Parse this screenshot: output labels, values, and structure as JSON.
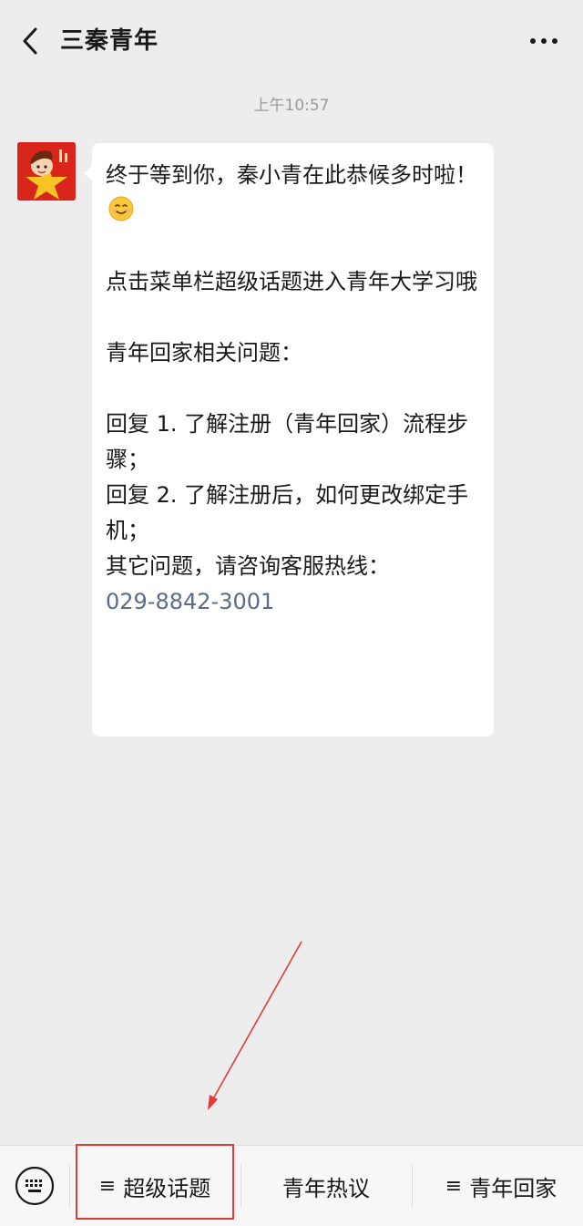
{
  "header": {
    "back_icon": "chevron-left-icon",
    "title": "三秦青年",
    "more_icon": "more-dots-icon"
  },
  "chat": {
    "timestamp": "上午10:57",
    "avatar": "mascot-avatar",
    "message": {
      "line1": "终于等到你，秦小青在此恭候多时啦！",
      "emoji": "smile-emoji-icon",
      "line2": "点击菜单栏超级话题进入青年大学习哦",
      "line3": "青年回家相关问题：",
      "line4": "回复 1. 了解注册（青年回家）流程步骤；",
      "line5": "回复 2. 了解注册后，如何更改绑定手机；",
      "line6": "其它问题，请咨询客服热线：",
      "phone": "029-8842-3001"
    }
  },
  "menu": {
    "keyboard_icon": "keyboard-icon",
    "items": [
      {
        "label": "超级话题",
        "has_submenu": true
      },
      {
        "label": "青年热议",
        "has_submenu": false
      },
      {
        "label": "青年回家",
        "has_submenu": true
      }
    ],
    "submenu_glyph": "≡"
  },
  "annotation": {
    "color": "#e53935",
    "target": "超级话题"
  },
  "colors": {
    "background": "#ededed",
    "bubble": "#ffffff",
    "link": "#5c6b87",
    "menu_bar": "#f7f7f7"
  }
}
